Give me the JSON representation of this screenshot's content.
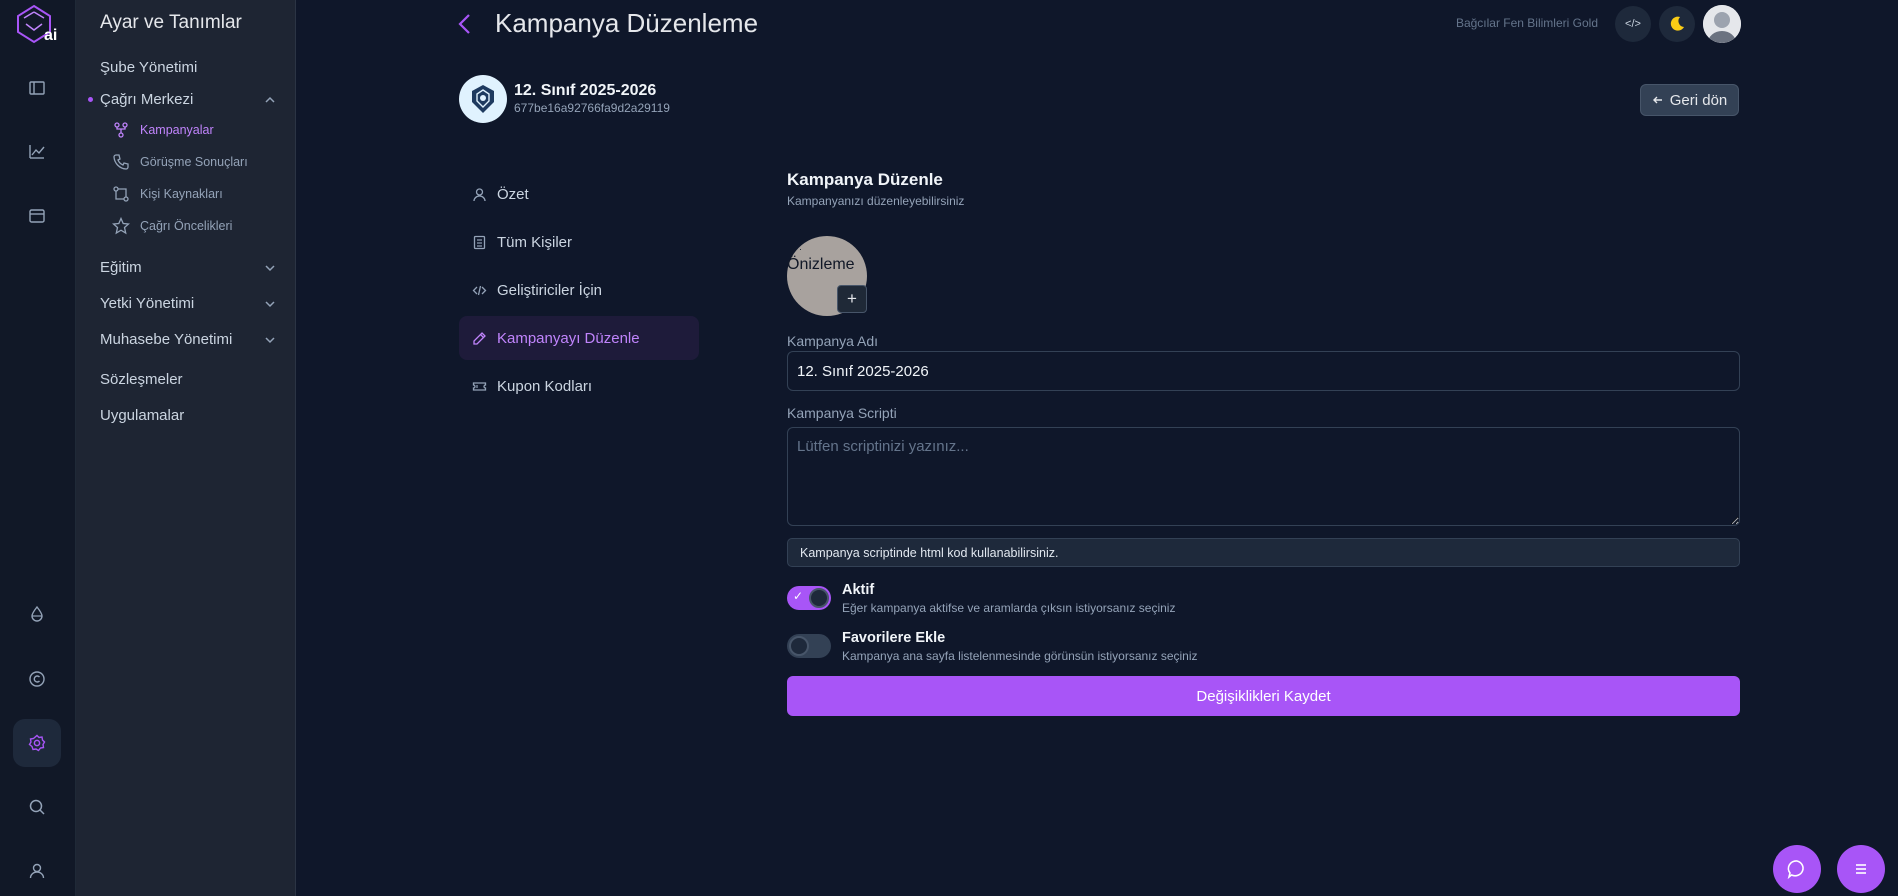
{
  "rail": {
    "logo_text": "ai",
    "icons": [
      "sidebar-icon",
      "chart-icon",
      "calendar-icon",
      "drop-icon",
      "copyright-icon",
      "settings-icon",
      "search-icon",
      "user-icon"
    ]
  },
  "menu": {
    "title": "Ayar ve Tanımlar",
    "items": [
      {
        "label": "Şube Yönetimi"
      },
      {
        "label": "Çağrı Merkezi"
      },
      {
        "label": "Eğitim"
      },
      {
        "label": "Yetki Yönetimi"
      },
      {
        "label": "Muhasebe Yönetimi"
      },
      {
        "label": "Sözleşmeler"
      },
      {
        "label": "Uygulamalar"
      }
    ],
    "sub_items": [
      {
        "label": "Kampanyalar",
        "icon": "branch-icon"
      },
      {
        "label": "Görüşme Sonuçları",
        "icon": "phone-icon"
      },
      {
        "label": "Kişi Kaynakları",
        "icon": "merge-icon"
      },
      {
        "label": "Çağrı Öncelikleri",
        "icon": "star-icon"
      }
    ]
  },
  "header": {
    "title": "Kampanya Düzenleme",
    "branch": "Bağcılar Fen Bilimleri Gold",
    "code_btn": "</>"
  },
  "campaign": {
    "name": "12. Sınıf 2025-2026",
    "id": "677be16a92766fa9d2a29119",
    "back_label": "Geri dön"
  },
  "tabs": [
    {
      "label": "Özet",
      "icon": "user-icon"
    },
    {
      "label": "Tüm Kişiler",
      "icon": "list-icon"
    },
    {
      "label": "Geliştiriciler İçin",
      "icon": "code-icon"
    },
    {
      "label": "Kampanyayı Düzenle",
      "icon": "pencil-icon"
    },
    {
      "label": "Kupon Kodları",
      "icon": "ticket-icon"
    }
  ],
  "form": {
    "title": "Kampanya Düzenle",
    "subtitle": "Kampanyanızı düzenleyebilirsiniz",
    "preview_label": "Önizleme",
    "preview_plus": "+",
    "name_label": "Kampanya Adı",
    "name_value": "12. Sınıf 2025-2026",
    "script_label": "Kampanya Scripti",
    "script_placeholder": "Lütfen scriptinizi yazınız...",
    "info": "Kampanya scriptinde html kod kullanabilirsiniz.",
    "active_label": "Aktif",
    "active_desc": "Eğer kampanya aktifse ve aramlarda çıksın istiyorsanız seçiniz",
    "active_on": true,
    "fav_label": "Favorilere Ekle",
    "fav_desc": "Kampanya ana sayfa listelenmesinde görünsün istiyorsanız seçiniz",
    "fav_on": false,
    "save_label": "Değişiklikleri Kaydet"
  },
  "colors": {
    "accent": "#a855f7",
    "background": "#0f172a"
  }
}
